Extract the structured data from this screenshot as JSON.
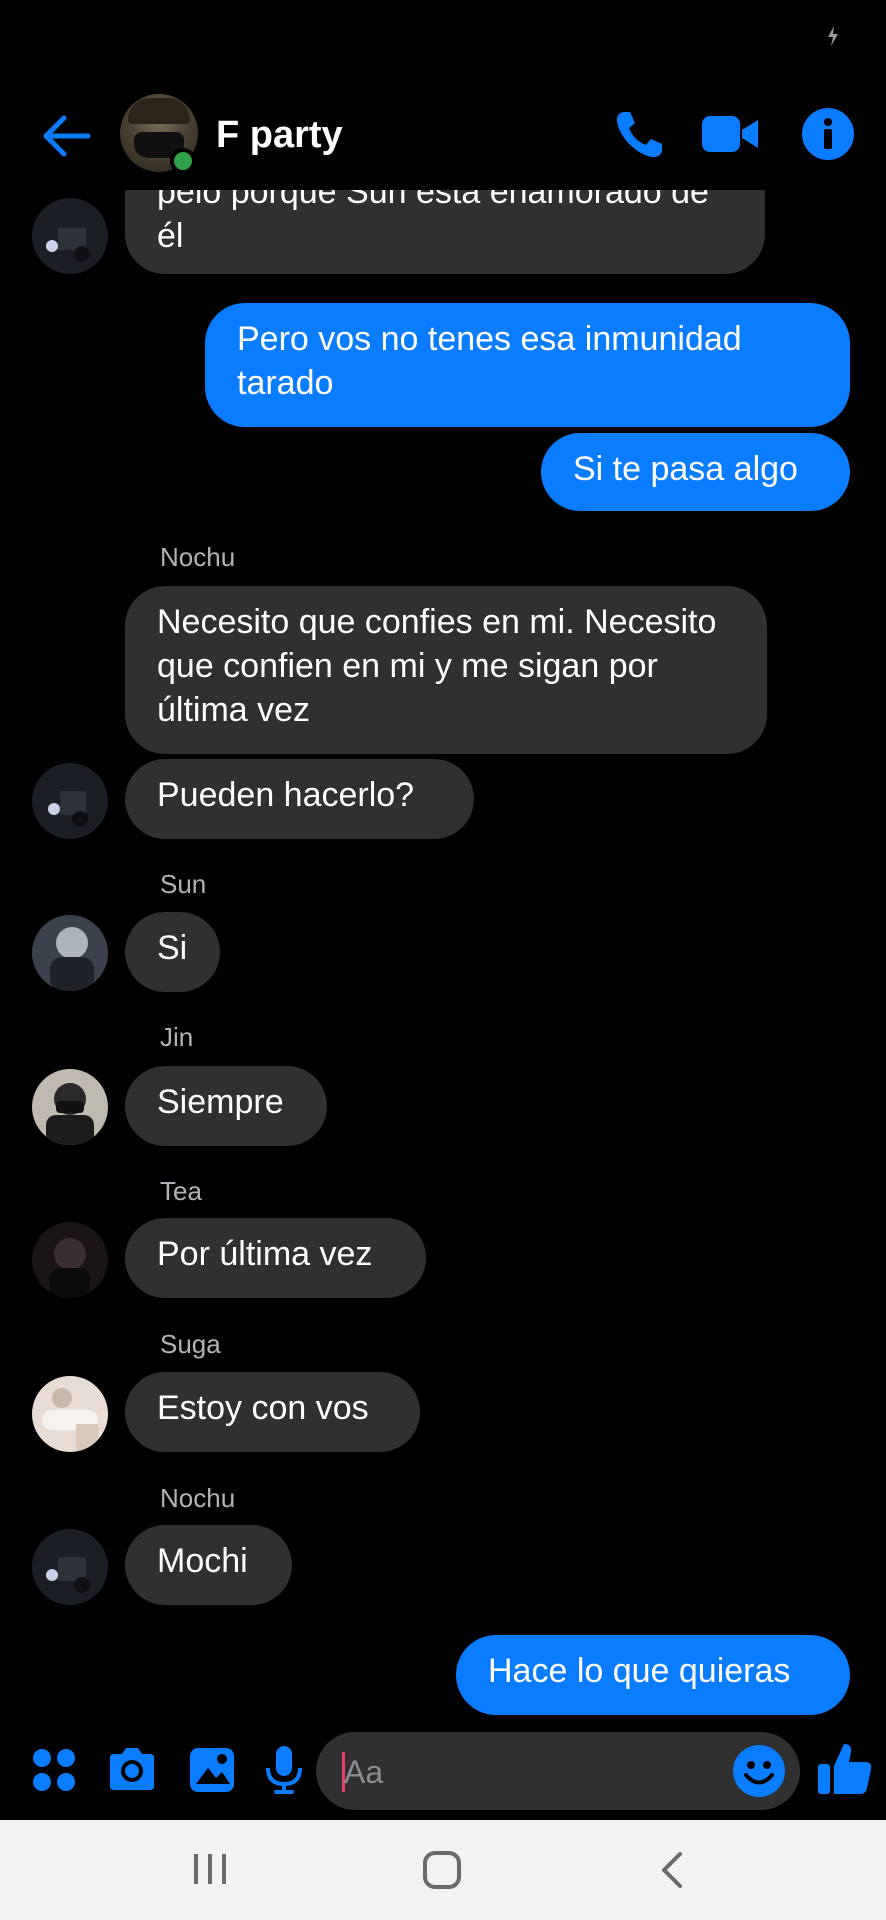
{
  "header": {
    "title": "F party",
    "back": "arrow-left-icon",
    "call": "phone-icon",
    "video": "video-camera-icon",
    "info": "info-icon"
  },
  "messages": {
    "m0": {
      "text": "pelo porque Sun esta enamorado de él"
    },
    "m1": {
      "text": "Pero vos no tenes esa inmunidad tarado"
    },
    "m2": {
      "text": "Si te pasa algo"
    },
    "s3": "Nochu",
    "m3": {
      "text": "Necesito que confies en mi. Necesito que confien en mi y me sigan por última vez"
    },
    "m4": {
      "text": "Pueden hacerlo?"
    },
    "s5": "Sun",
    "m5": {
      "text": "Si"
    },
    "s6": "Jin",
    "m6": {
      "text": "Siempre"
    },
    "s7": "Tea",
    "m7": {
      "text": "Por última vez"
    },
    "s8": "Suga",
    "m8": {
      "text": "Estoy con vos"
    },
    "s9": "Nochu",
    "m9": {
      "text": "Mochi"
    },
    "m10": {
      "text": "Hace lo que quieras"
    }
  },
  "composer": {
    "placeholder": "Aa",
    "icons": [
      "apps-icon",
      "camera-icon",
      "gallery-icon",
      "microphone-icon",
      "emoji-icon",
      "thumbs-up-icon"
    ]
  },
  "colors": {
    "accent": "#0a7cff",
    "incoming_bubble": "#303030",
    "background": "#000000",
    "online": "#31a24c"
  },
  "navbar": {
    "icons": [
      "recent-apps-icon",
      "home-icon",
      "back-icon"
    ]
  }
}
